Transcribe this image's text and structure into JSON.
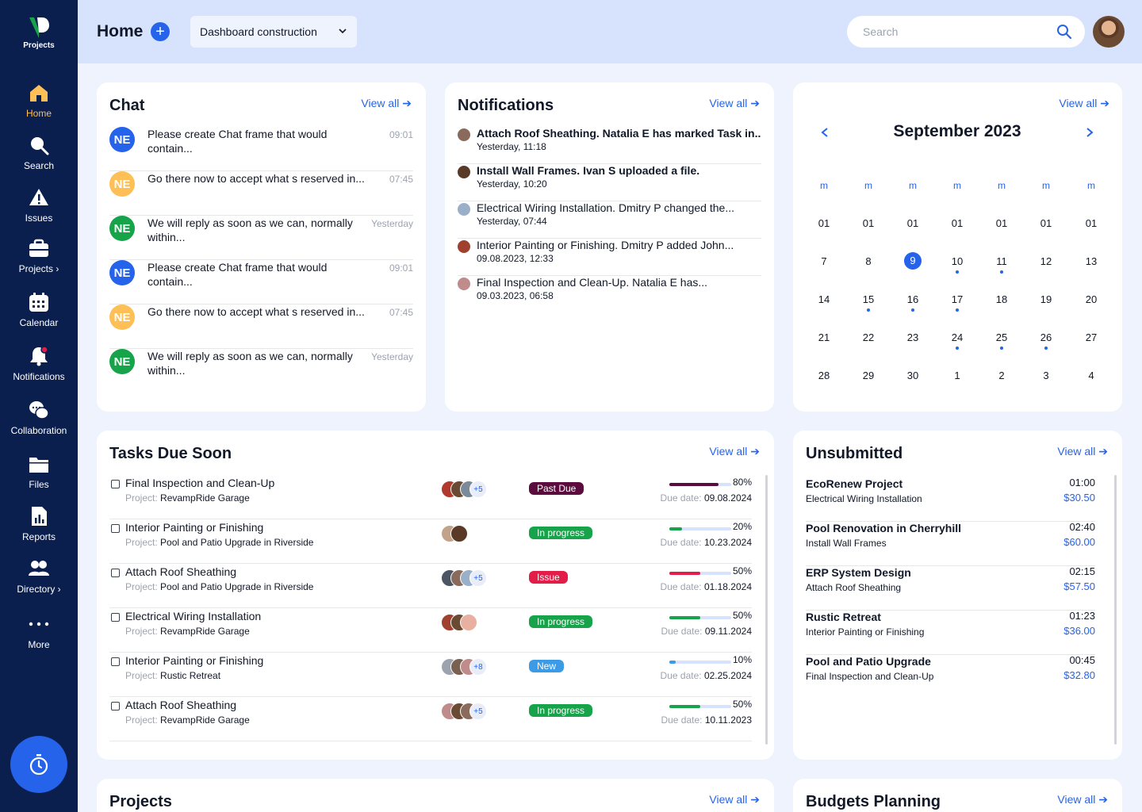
{
  "sidebar": {
    "logo_text": "Projects",
    "items": [
      {
        "label": "Home"
      },
      {
        "label": "Search"
      },
      {
        "label": "Issues"
      },
      {
        "label": "Projects ›"
      },
      {
        "label": "Calendar"
      },
      {
        "label": "Notifications"
      },
      {
        "label": "Collaboration"
      },
      {
        "label": "Files"
      },
      {
        "label": "Reports"
      },
      {
        "label": "Directory ›"
      },
      {
        "label": "More"
      }
    ]
  },
  "header": {
    "title": "Home",
    "select_value": "Dashboard construction",
    "search_placeholder": "Search"
  },
  "view_all": "View all",
  "chat": {
    "title": "Chat",
    "messages": [
      {
        "initials": "NE",
        "text": "Please create Chat frame that would contain...",
        "time": "09:01",
        "color": "#2563eb"
      },
      {
        "initials": "NE",
        "text": "Go there now to accept what s reserved in...",
        "time": "07:45",
        "color": "#fdbf56"
      },
      {
        "initials": "NE",
        "text": "We will reply as soon as we can, normally within...",
        "time": "Yesterday",
        "color": "#16a34a"
      },
      {
        "initials": "NE",
        "text": "Please create Chat frame that would contain...",
        "time": "09:01",
        "color": "#2563eb"
      },
      {
        "initials": "NE",
        "text": "Go there now to accept what s reserved in...",
        "time": "07:45",
        "color": "#fdbf56"
      },
      {
        "initials": "NE",
        "text": "We will reply as soon as we can, normally within...",
        "time": "Yesterday",
        "color": "#16a34a"
      }
    ]
  },
  "notifications": {
    "title": "Notifications",
    "items": [
      {
        "text": "Attach Roof Sheathing. Natalia E has marked Task in..",
        "date": "Yesterday, 11:18",
        "bold": true
      },
      {
        "text": "Install Wall Frames. Ivan S uploaded a file.",
        "date": "Yesterday, 10:20",
        "bold": true
      },
      {
        "text": "Electrical Wiring Installation. Dmitry P changed the...",
        "date": "Yesterday, 07:44",
        "bold": false
      },
      {
        "text": "Interior Painting or Finishing. Dmitry P added John...",
        "date": "09.08.2023, 12:33",
        "bold": false
      },
      {
        "text": "Final Inspection and Clean-Up. Natalia E has...",
        "date": "09.03.2023, 06:58",
        "bold": false
      }
    ]
  },
  "calendar": {
    "month": "September 2023",
    "weekday_headers": [
      "m",
      "m",
      "m",
      "m",
      "m",
      "m",
      "m"
    ],
    "weeks": [
      [
        "01",
        "01",
        "01",
        "01",
        "01",
        "01",
        "01"
      ],
      [
        "7",
        "8",
        "9",
        "10",
        "11",
        "12",
        "13"
      ],
      [
        "14",
        "15",
        "16",
        "17",
        "18",
        "19",
        "20"
      ],
      [
        "21",
        "22",
        "23",
        "24",
        "25",
        "26",
        "27"
      ],
      [
        "28",
        "29",
        "30",
        "1",
        "2",
        "3",
        "4"
      ]
    ],
    "selected_day": "9",
    "event_days": [
      "10",
      "11",
      "15",
      "16",
      "17",
      "24",
      "25",
      "26"
    ]
  },
  "tasks": {
    "title": "Tasks Due Soon",
    "project_label": "Project:",
    "due_label": "Due date:",
    "rows": [
      {
        "name": "Final Inspection and Clean-Up",
        "project": "RevampRide Garage",
        "more": "+5",
        "status": "Past Due",
        "status_color": "#5b0b3d",
        "progress": 0.8,
        "progress_text": "80%",
        "progress_color": "#5b0b3d",
        "due": "09.08.2024"
      },
      {
        "name": "Interior Painting or Finishing",
        "project": "Pool and Patio Upgrade in Riverside",
        "more": "",
        "status": "In progress",
        "status_color": "#16a34a",
        "progress": 0.2,
        "progress_text": "20%",
        "progress_color": "#16a34a",
        "due": "10.23.2024"
      },
      {
        "name": "Attach Roof Sheathing",
        "project": "Pool and Patio Upgrade in Riverside",
        "more": "+5",
        "status": "Issue",
        "status_color": "#e11d48",
        "progress": 0.5,
        "progress_text": "50%",
        "progress_color": "#e11d48",
        "due": "01.18.2024"
      },
      {
        "name": "Electrical Wiring Installation",
        "project": "RevampRide Garage",
        "more": "",
        "status": "In progress",
        "status_color": "#16a34a",
        "progress": 0.5,
        "progress_text": "50%",
        "progress_color": "#16a34a",
        "due": "09.11.2024"
      },
      {
        "name": "Interior Painting or Finishing",
        "project": "Rustic Retreat",
        "more": "+8",
        "status": "New",
        "status_color": "#3b9be6",
        "progress": 0.1,
        "progress_text": "10%",
        "progress_color": "#3b9be6",
        "due": "02.25.2024"
      },
      {
        "name": "Attach Roof Sheathing",
        "project": "RevampRide Garage",
        "more": "+5",
        "status": "In progress",
        "status_color": "#16a34a",
        "progress": 0.5,
        "progress_text": "50%",
        "progress_color": "#16a34a",
        "due": "10.11.2023"
      }
    ]
  },
  "unsubmitted": {
    "title": "Unsubmitted",
    "rows": [
      {
        "name": "EcoRenew Project",
        "sub": "Electrical Wiring Installation",
        "time": "01:00",
        "amount": "$30.50"
      },
      {
        "name": "Pool Renovation in Cherryhill",
        "sub": "Install Wall Frames",
        "time": "02:40",
        "amount": "$60.00"
      },
      {
        "name": "ERP System Design",
        "sub": "Attach Roof Sheathing",
        "time": "02:15",
        "amount": "$57.50"
      },
      {
        "name": "Rustic Retreat",
        "sub": "Interior Painting or Finishing",
        "time": "01:23",
        "amount": "$36.00"
      },
      {
        "name": "Pool and Patio Upgrade",
        "sub": "Final Inspection and Clean-Up",
        "time": "00:45",
        "amount": "$32.80"
      }
    ]
  },
  "projects": {
    "title": "Projects"
  },
  "budgets": {
    "title": "Budgets Planning"
  }
}
